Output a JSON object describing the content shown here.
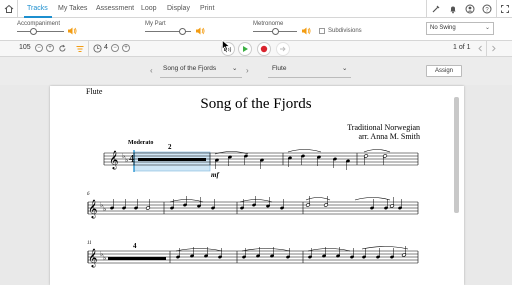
{
  "tabs": [
    {
      "label": "Tracks",
      "active": true
    },
    {
      "label": "My Takes"
    },
    {
      "label": "Assessment"
    },
    {
      "label": "Loop"
    },
    {
      "label": "Display"
    },
    {
      "label": "Print"
    }
  ],
  "toolbar_icons": [
    "home-icon",
    "tuner-icon",
    "bell-icon",
    "user-icon",
    "help-icon",
    "expand-icon"
  ],
  "mixer": {
    "accompaniment_label": "Accompaniment",
    "accompaniment_level": 0.35,
    "my_part_label": "My Part",
    "my_part_level": 0.82,
    "metronome_label": "Metronome",
    "metronome_level": 0.5,
    "subdivisions_label": "Subdivisions",
    "subdivisions_checked": false,
    "swing_value": "No Swing"
  },
  "transport": {
    "tempo": "105",
    "count_in": "4",
    "page_indicator": "1 of 1",
    "accent_color": "#f39c12",
    "play_color": "#3cb043",
    "record_color": "#d9232d"
  },
  "score_toolbar": {
    "piece_select": "Song of the Fjords",
    "part_select": "Flute",
    "assign_label": "Assign"
  },
  "score": {
    "instrument": "Flute",
    "title": "Song of the Fjords",
    "composer_line1": "Traditional Norwegian",
    "composer_line2": "arr. Anna M. Smith",
    "tempo_marking": "Moderato",
    "rest_count_1": "2",
    "dynamic": "mf",
    "measure_number_2": "6",
    "measure_number_3": "11",
    "rest_count_3": "4"
  }
}
